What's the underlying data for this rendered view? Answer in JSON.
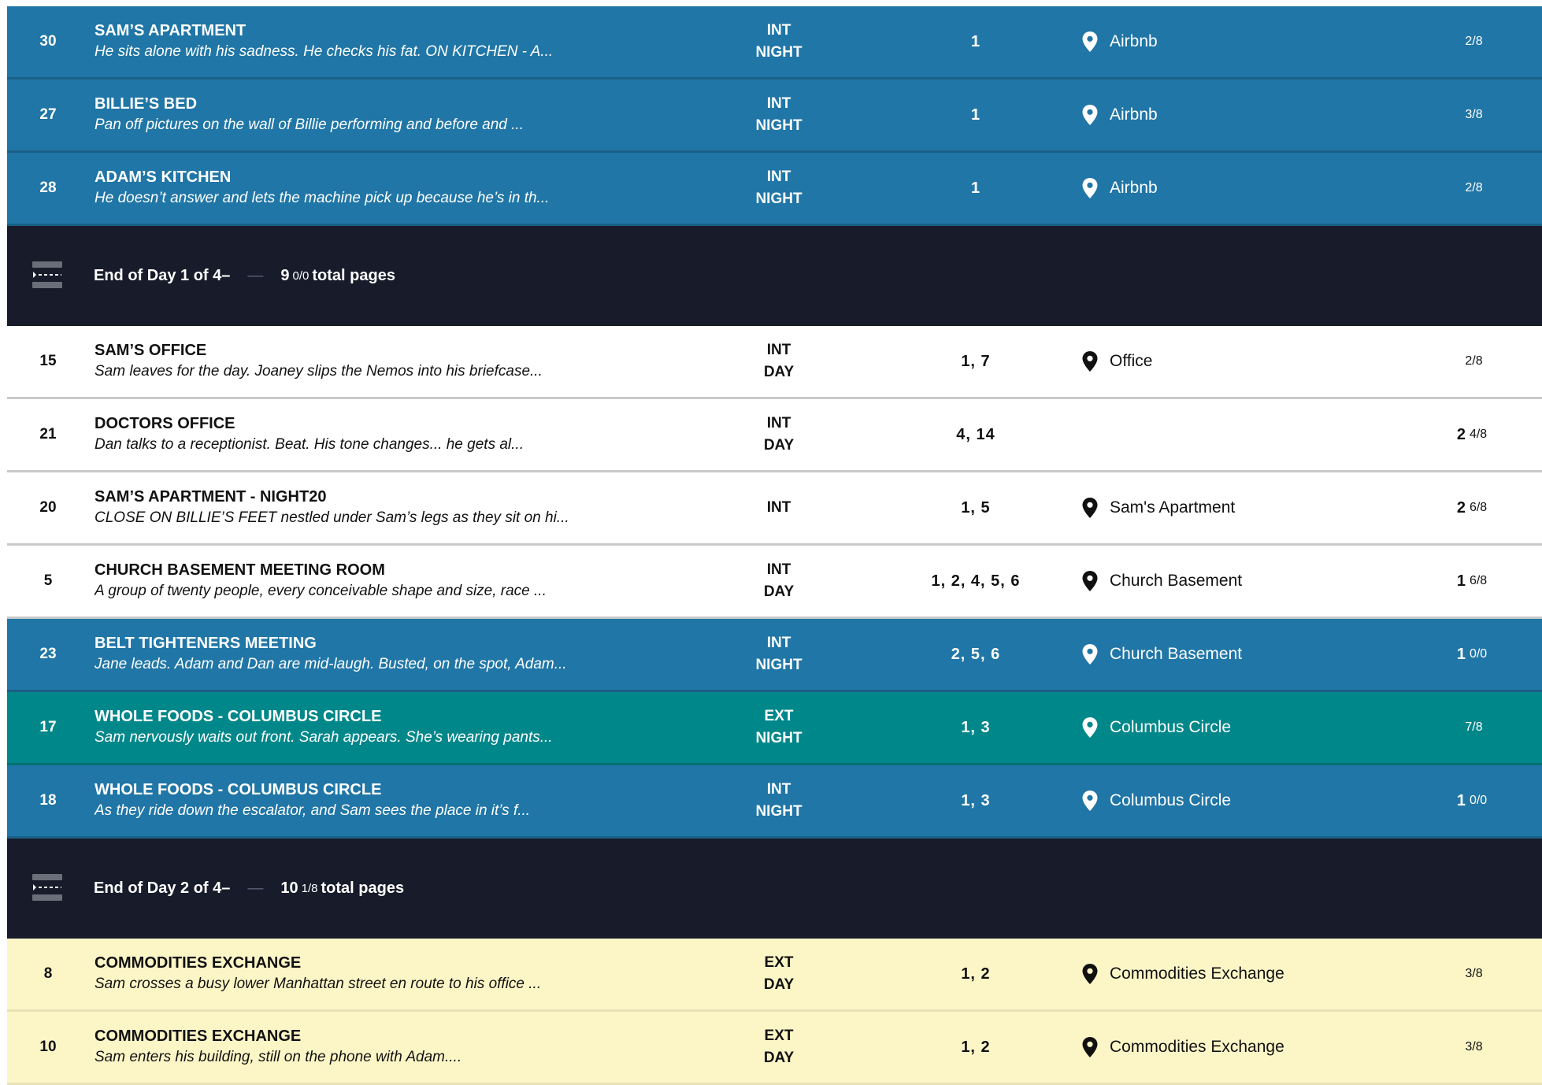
{
  "strips": [
    {
      "kind": "scene",
      "color": "blue",
      "scene": "30",
      "heading": "SAM’S APARTMENT",
      "synopsis": "He sits alone with his sadness. He checks his fat. ON KITCHEN - A...",
      "ie": "INT",
      "dn": "NIGHT",
      "cast": "1",
      "location": "Airbnb",
      "pages_whole": "",
      "pages_frac": "2/8"
    },
    {
      "kind": "scene",
      "color": "blue",
      "scene": "27",
      "heading": "BILLIE’S BED",
      "synopsis": "Pan off pictures on the wall of Billie performing and before and ...",
      "ie": "INT",
      "dn": "NIGHT",
      "cast": "1",
      "location": "Airbnb",
      "pages_whole": "",
      "pages_frac": "3/8"
    },
    {
      "kind": "scene",
      "color": "blue",
      "scene": "28",
      "heading": "ADAM’S KITCHEN",
      "synopsis": "He doesn’t answer and lets the machine pick up because he’s in th...",
      "ie": "INT",
      "dn": "NIGHT",
      "cast": "1",
      "location": "Airbnb",
      "pages_whole": "",
      "pages_frac": "2/8"
    },
    {
      "kind": "day",
      "label": "End of  Day 1 of 4–",
      "dash": "—",
      "total_whole": "9",
      "total_frac": "0/0",
      "total_label": "total pages"
    },
    {
      "kind": "scene",
      "color": "white",
      "scene": "15",
      "heading": "SAM’S OFFICE",
      "synopsis": "Sam leaves for the day. Joaney slips the Nemos into his briefcase...",
      "ie": "INT",
      "dn": "DAY",
      "cast": "1, 7",
      "location": "Office",
      "pages_whole": "",
      "pages_frac": "2/8"
    },
    {
      "kind": "scene",
      "color": "white",
      "scene": "21",
      "heading": "DOCTORS OFFICE",
      "synopsis": "Dan talks to a receptionist. Beat. His tone changes... he gets al...",
      "ie": "INT",
      "dn": "DAY",
      "cast": "4, 14",
      "location": "",
      "pages_whole": "2",
      "pages_frac": "4/8"
    },
    {
      "kind": "scene",
      "color": "white",
      "scene": "20",
      "heading": "SAM’S APARTMENT - NIGHT20",
      "synopsis": "CLOSE ON BILLIE’S FEET nestled under Sam’s legs as they sit on hi...",
      "ie": "INT",
      "dn": "",
      "cast": "1, 5",
      "location": "Sam's Apartment",
      "pages_whole": "2",
      "pages_frac": "6/8"
    },
    {
      "kind": "scene",
      "color": "white",
      "scene": "5",
      "heading": "CHURCH BASEMENT MEETING ROOM",
      "synopsis": "A group of twenty people, every conceivable shape and size, race ...",
      "ie": "INT",
      "dn": "DAY",
      "cast": "1, 2, 4, 5, 6",
      "location": "Church Basement",
      "pages_whole": "1",
      "pages_frac": "6/8"
    },
    {
      "kind": "scene",
      "color": "blue",
      "scene": "23",
      "heading": "BELT TIGHTENERS MEETING",
      "synopsis": "Jane leads. Adam and Dan are mid-laugh. Busted, on the spot, Adam...",
      "ie": "INT",
      "dn": "NIGHT",
      "cast": "2, 5, 6",
      "location": "Church Basement",
      "pages_whole": "1",
      "pages_frac": "0/0"
    },
    {
      "kind": "scene",
      "color": "teal",
      "scene": "17",
      "heading": "WHOLE FOODS - COLUMBUS CIRCLE",
      "synopsis": "Sam nervously waits out front. Sarah appears. She’s wearing pants...",
      "ie": "EXT",
      "dn": "NIGHT",
      "cast": "1, 3",
      "location": "Columbus Circle",
      "pages_whole": "",
      "pages_frac": "7/8"
    },
    {
      "kind": "scene",
      "color": "blue",
      "scene": "18",
      "heading": "WHOLE FOODS - COLUMBUS CIRCLE",
      "synopsis": "As they ride down the escalator, and Sam sees the place in it’s f...",
      "ie": "INT",
      "dn": "NIGHT",
      "cast": "1, 3",
      "location": "Columbus Circle",
      "pages_whole": "1",
      "pages_frac": "0/0"
    },
    {
      "kind": "day",
      "label": "End of  Day 2 of 4–",
      "dash": "—",
      "total_whole": "10",
      "total_frac": "1/8",
      "total_label": "total pages"
    },
    {
      "kind": "scene",
      "color": "yellow",
      "scene": "8",
      "heading": "COMMODITIES EXCHANGE",
      "synopsis": "Sam crosses a busy lower Manhattan street en route to his office ...",
      "ie": "EXT",
      "dn": "DAY",
      "cast": "1, 2",
      "location": "Commodities Exchange",
      "pages_whole": "",
      "pages_frac": "3/8"
    },
    {
      "kind": "scene",
      "color": "yellow",
      "scene": "10",
      "heading": "COMMODITIES EXCHANGE",
      "synopsis": "Sam enters his building, still on the phone with Adam....",
      "ie": "EXT",
      "dn": "DAY",
      "cast": "1, 2",
      "location": "Commodities Exchange",
      "pages_whole": "",
      "pages_frac": "3/8"
    }
  ],
  "icons": {
    "location": "map-pin-icon",
    "day_break": "day-break-icon"
  }
}
